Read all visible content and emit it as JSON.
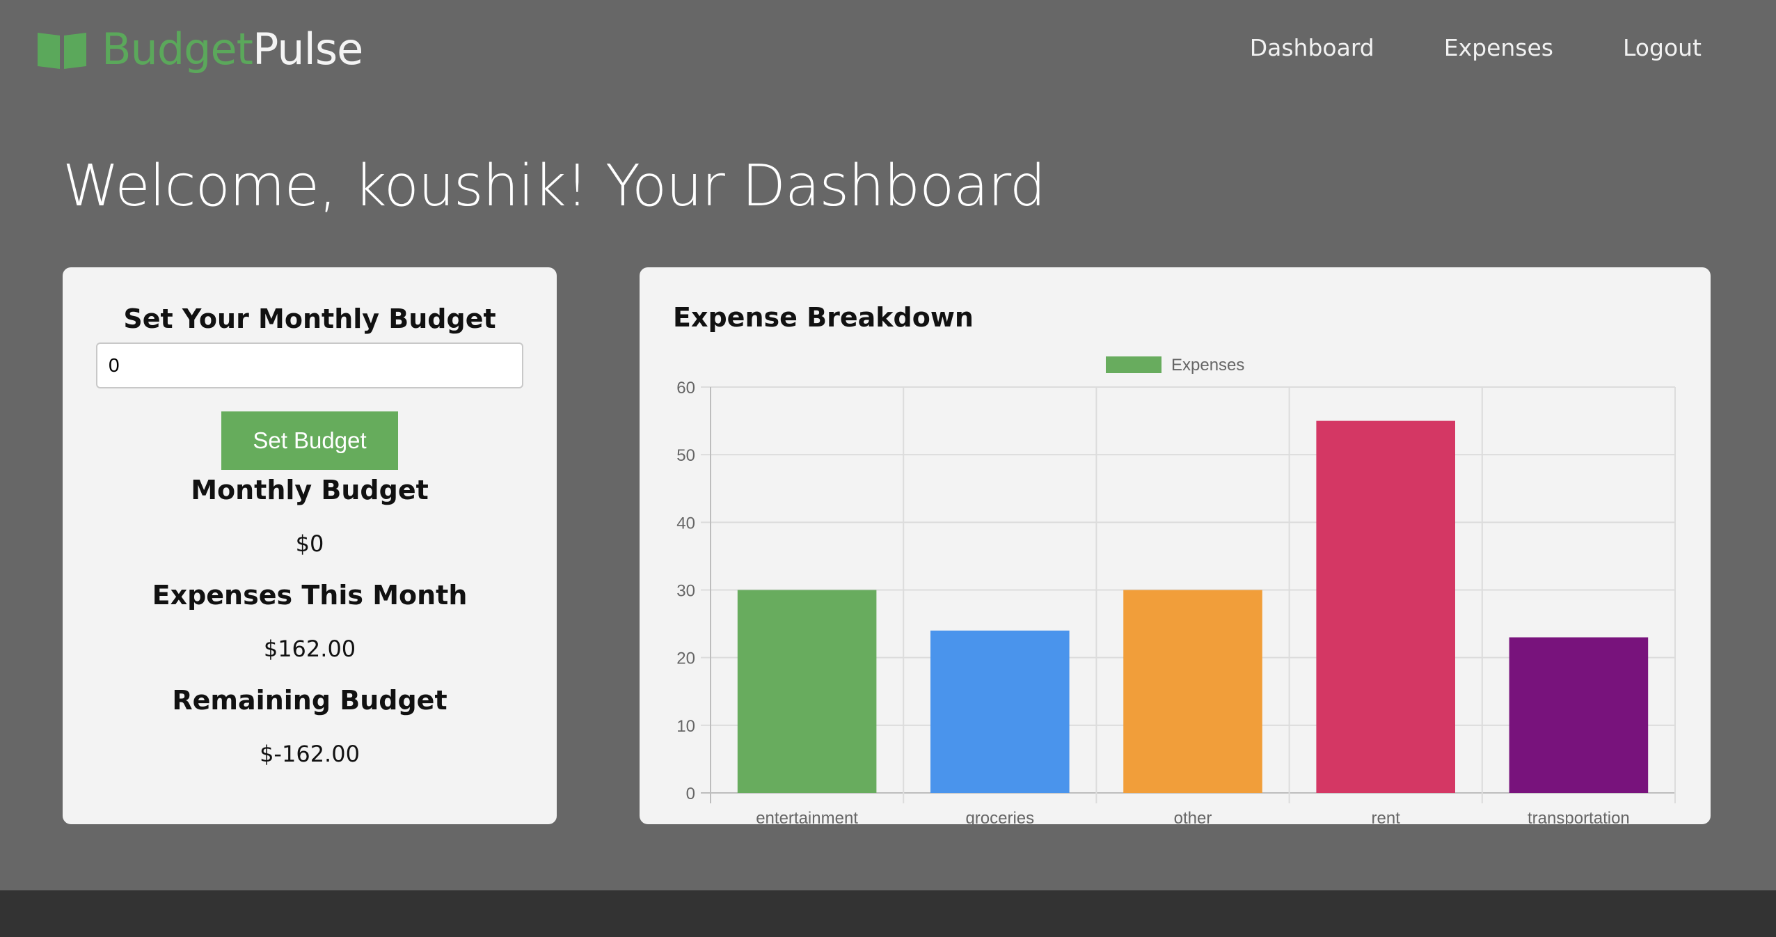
{
  "brand": {
    "part1": "Budget",
    "part2": "Pulse",
    "icon": "open-book-icon",
    "color_part1": "#5ba85b"
  },
  "nav": {
    "items": [
      "Dashboard",
      "Expenses",
      "Logout"
    ]
  },
  "page": {
    "title": "Welcome, koushik! Your Dashboard"
  },
  "budget_form": {
    "heading": "Set Your Monthly Budget",
    "input_value": "0",
    "button_label": "Set Budget",
    "button_color": "#66ac5c"
  },
  "stats": {
    "monthly_budget_label": "Monthly Budget",
    "monthly_budget_value": "$0",
    "expenses_label": "Expenses This Month",
    "expenses_value": "$162.00",
    "remaining_label": "Remaining Budget",
    "remaining_value": "$-162.00"
  },
  "chart": {
    "title": "Expense Breakdown"
  },
  "chart_data": {
    "type": "bar",
    "categories": [
      "entertainment",
      "groceries",
      "other",
      "rent",
      "transportation"
    ],
    "series": [
      {
        "name": "Expenses",
        "values": [
          30,
          24,
          30,
          55,
          23
        ]
      }
    ],
    "bar_colors": [
      "#68ac5e",
      "#4a94ec",
      "#f19e3a",
      "#d43764",
      "#78137c"
    ],
    "legend_color": "#68ac5e",
    "ylim": [
      0,
      60
    ],
    "yticks": [
      0,
      10,
      20,
      30,
      40,
      50,
      60
    ],
    "legend_position": "top",
    "grid": true
  }
}
